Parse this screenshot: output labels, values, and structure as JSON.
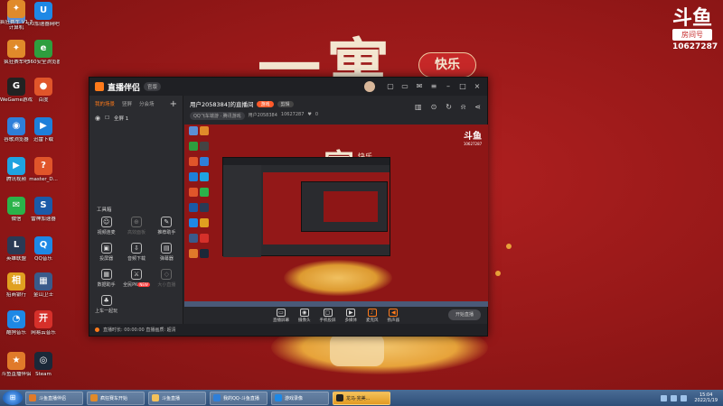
{
  "wallpaper": {
    "big_text": "一寓",
    "happy_text": "快乐"
  },
  "room_logo": {
    "logo_char": "斗鱼",
    "label": "房间号",
    "number": "10627287"
  },
  "desktop_icons": [
    {
      "label": "计算机",
      "color": "#5b8fd6",
      "glyph": "▭"
    },
    {
      "label": "UU加速器网吧",
      "color": "#1e88e5",
      "glyph": "U"
    },
    {
      "label": "疯狂赛车吧",
      "color": "#e08a2a",
      "glyph": "✦"
    },
    {
      "label": "360安全浏览器",
      "color": "#2e9e3e",
      "glyph": "e"
    },
    {
      "label": "WeGame游戏平台",
      "color": "#222222",
      "glyph": "G"
    },
    {
      "label": "百度",
      "color": "#e0552a",
      "glyph": "●"
    },
    {
      "label": "谷歌浏览器",
      "color": "#2f7fd9",
      "glyph": "◉"
    },
    {
      "label": "迅雷下载",
      "color": "#1e7fd9",
      "glyph": "▶"
    },
    {
      "label": "腾讯视频",
      "color": "#1fa3e0",
      "glyph": "▶"
    },
    {
      "label": "master_D...",
      "color": "#e0552a",
      "glyph": "?"
    },
    {
      "label": "微信",
      "color": "#2bb34a",
      "glyph": "✉"
    },
    {
      "label": "雷神加速器",
      "color": "#1b5aa8",
      "glyph": "S"
    },
    {
      "label": "英雄联盟",
      "color": "#2a3a55",
      "glyph": "L"
    },
    {
      "label": "QQ音乐",
      "color": "#1e88e5",
      "glyph": "Q"
    },
    {
      "label": "招商银行",
      "color": "#e0a020",
      "glyph": "相"
    },
    {
      "label": "金山卫士",
      "color": "#3a5a8a",
      "glyph": "▦"
    },
    {
      "label": "酷狗音乐",
      "color": "#1e88e5",
      "glyph": "◔"
    },
    {
      "label": "网易云音乐",
      "color": "#d6302a",
      "glyph": "开"
    },
    {
      "label": "斗鱼直播伴侣",
      "color": "#e07a2a",
      "glyph": "★"
    },
    {
      "label": "Steam",
      "color": "#1b2838",
      "glyph": "◎"
    },
    {
      "label": "疯狂赛车 V1.3988002",
      "color": "#e08a2a",
      "glyph": "✦"
    }
  ],
  "app": {
    "title": "直播伴侣",
    "version": "官版",
    "sidebar_tabs": [
      "我的场景",
      "竖屏",
      "分会场"
    ],
    "scene_name": "全屏 1",
    "tools_title": "工具箱",
    "tools": [
      {
        "label": "视频连麦",
        "glyph": "☺",
        "dim": false
      },
      {
        "label": "高效面板",
        "glyph": "⊕",
        "dim": true
      },
      {
        "label": "推荐助手",
        "glyph": "✎",
        "dim": false
      },
      {
        "label": "投屏器",
        "glyph": "▣",
        "dim": false
      },
      {
        "label": "音频下载",
        "glyph": "⇩",
        "dim": false
      },
      {
        "label": "弹幕器",
        "glyph": "▤",
        "dim": false
      },
      {
        "label": "数据助手",
        "glyph": "▦",
        "dim": false
      },
      {
        "label": "全民PK",
        "glyph": "⚔",
        "dim": false,
        "badge": "NEW"
      },
      {
        "label": "大小直播",
        "glyph": "◇",
        "dim": true
      },
      {
        "label": "上车一起玩",
        "glyph": "♣",
        "dim": false
      }
    ],
    "room": {
      "title": "用户2058384]的直播间",
      "tag1": "游戏",
      "tag2": "剪辑",
      "category": "QQ飞车端游 · 腾讯游戏",
      "user_id": "用户2058384",
      "room_id": "10627287",
      "likes": "0"
    },
    "preview": {
      "big_text": "一寓",
      "happy_text": "快乐",
      "logo_char": "斗鱼",
      "logo_num": "10627287"
    },
    "controls": [
      {
        "label": "直播屏幕",
        "glyph": "▭"
      },
      {
        "label": "摄像头",
        "glyph": "◉"
      },
      {
        "label": "手机投屏",
        "glyph": "▢"
      },
      {
        "label": "多媒体",
        "glyph": "▶"
      },
      {
        "label": "麦克风",
        "glyph": "♪",
        "orange": true
      },
      {
        "label": "扬声器",
        "glyph": "◀",
        "orange": true
      }
    ],
    "live_button": "开始直播",
    "status_text": "直播时长: 00:00:00 直播画质: 超清"
  },
  "taskbar": {
    "items": [
      {
        "label": "斗鱼直播伴侣",
        "active": false,
        "color": "#e07a2a"
      },
      {
        "label": "疯狂赛车开始",
        "active": false,
        "color": "#e08a2a"
      },
      {
        "label": "斗鱼直播",
        "active": false,
        "color": "#f3c15a"
      },
      {
        "label": "我的QQ-斗鱼直播",
        "active": false,
        "color": "#2f7fd9"
      },
      {
        "label": "游戏录像",
        "active": false,
        "color": "#1e88e5"
      },
      {
        "label": "龙马·完美...",
        "active": true,
        "color": "#222222"
      }
    ],
    "time": "15:04",
    "date": "2022/1/19"
  }
}
